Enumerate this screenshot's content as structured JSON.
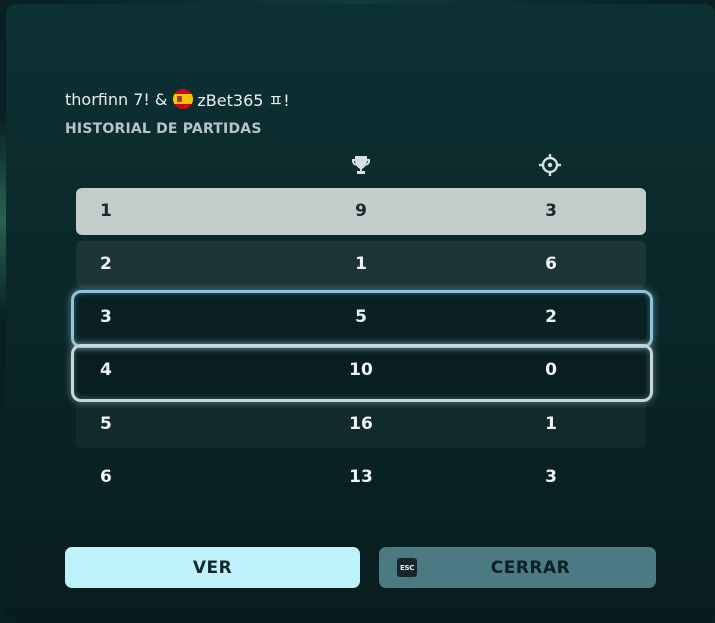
{
  "header": {
    "player1": "thorfinn 7! &",
    "flag_icon": "spain-flag-icon",
    "player2": "zBet365 ㅍ!",
    "subtitle": "HISTORIAL DE PARTIDAS"
  },
  "columns": {
    "col2_icon": "trophy-icon",
    "col3_icon": "crosshair-icon"
  },
  "rows": [
    {
      "index": "1",
      "trophies": "9",
      "kills": "3"
    },
    {
      "index": "2",
      "trophies": "1",
      "kills": "6"
    },
    {
      "index": "3",
      "trophies": "5",
      "kills": "2"
    },
    {
      "index": "4",
      "trophies": "10",
      "kills": "0"
    },
    {
      "index": "5",
      "trophies": "16",
      "kills": "1"
    },
    {
      "index": "6",
      "trophies": "13",
      "kills": "3"
    }
  ],
  "buttons": {
    "ver": "VER",
    "esc_key": "ESC",
    "cerrar": "CERRAR"
  },
  "colors": {
    "accent": "#bff3fb",
    "secondary_button": "#4b7a83",
    "highlight_row": "#c4cccc"
  }
}
